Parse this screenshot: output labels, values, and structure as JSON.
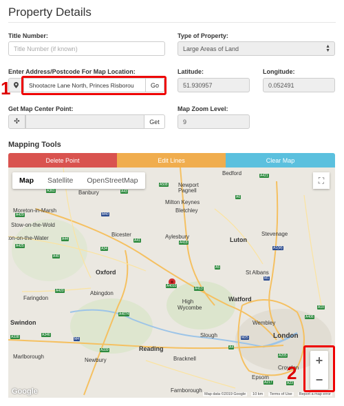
{
  "page_title": "Property Details",
  "fields": {
    "title_number": {
      "label": "Title Number:",
      "placeholder": "Title Number (if known)"
    },
    "type_of_property": {
      "label": "Type of Property:",
      "value": "Large Areas of Land"
    },
    "address": {
      "label": "Enter Address/Postcode For Map Location:",
      "value": "Shootacre Lane North, Princes Risborou",
      "go_label": "Go"
    },
    "latitude": {
      "label": "Latitude:",
      "value": "51.930957"
    },
    "longitude": {
      "label": "Longitude:",
      "value": "0.052491"
    },
    "map_center": {
      "label": "Get Map Center Point:",
      "get_label": "Get"
    },
    "zoom_level": {
      "label": "Map Zoom Level:",
      "value": "9"
    }
  },
  "mapping_tools": {
    "heading": "Mapping Tools",
    "delete_point": "Delete Point",
    "edit_lines": "Edit Lines",
    "clear_map": "Clear Map"
  },
  "colors": {
    "delete": "#d9534f",
    "edit": "#f0ad4e",
    "clear": "#5bc0de",
    "annotation": "#e00000"
  },
  "annotations": {
    "one": "1",
    "two": "2"
  },
  "map": {
    "type_tabs": [
      "Map",
      "Satellite",
      "OpenStreetMap"
    ],
    "active_tab": "Map",
    "places": [
      {
        "name": "Banbury"
      },
      {
        "name": "Bedford"
      },
      {
        "name": "Newport Pagnell"
      },
      {
        "name": "Milton Keynes"
      },
      {
        "name": "Bletchley"
      },
      {
        "name": "Moreton-in-Marsh"
      },
      {
        "name": "Stow-on-the-Wold"
      },
      {
        "name": "Bicester"
      },
      {
        "name": "Luton"
      },
      {
        "name": "Stevenage"
      },
      {
        "name": "Burton-on-the-Water"
      },
      {
        "name": "Aylesbury"
      },
      {
        "name": "Oxford"
      },
      {
        "name": "St Albans"
      },
      {
        "name": "Abingdon"
      },
      {
        "name": "High Wycombe"
      },
      {
        "name": "Watford"
      },
      {
        "name": "Faringdon"
      },
      {
        "name": "Swindon"
      },
      {
        "name": "Wembley"
      },
      {
        "name": "Slough"
      },
      {
        "name": "London"
      },
      {
        "name": "Marlborough"
      },
      {
        "name": "Newbury"
      },
      {
        "name": "Reading"
      },
      {
        "name": "Bracknell"
      },
      {
        "name": "Epsom"
      },
      {
        "name": "Croydon"
      },
      {
        "name": "Farnborough"
      }
    ],
    "road_labels": [
      "M40",
      "A41",
      "A418",
      "A4010",
      "A413",
      "M1",
      "M25",
      "M4",
      "A34",
      "A420",
      "A44",
      "A421",
      "A6",
      "A508",
      "A1(M)",
      "A43",
      "A361",
      "A429",
      "A425",
      "A40",
      "A4074",
      "A346",
      "A338",
      "A339",
      "A4",
      "A5",
      "A10",
      "A406",
      "A205",
      "A217",
      "A23"
    ],
    "zoom_in": "+",
    "zoom_out": "−",
    "footer": [
      "Map data ©2019 Google",
      "10 km",
      "Terms of Use",
      "Report a map error"
    ],
    "google_logo": "Google"
  }
}
